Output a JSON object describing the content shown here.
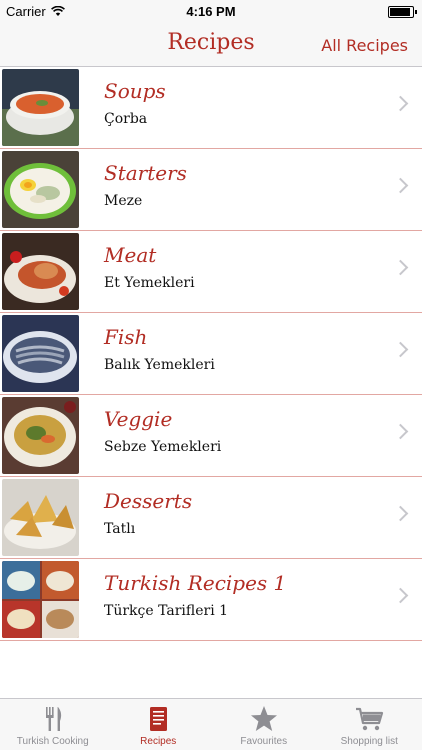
{
  "status": {
    "carrier": "Carrier",
    "time": "4:16 PM"
  },
  "nav": {
    "title": "Recipes",
    "right_button": "All Recipes"
  },
  "rows": [
    {
      "title": "Soups",
      "subtitle": "Çorba"
    },
    {
      "title": "Starters",
      "subtitle": "Meze"
    },
    {
      "title": "Meat",
      "subtitle": "Et Yemekleri"
    },
    {
      "title": "Fish",
      "subtitle": "Balık Yemekleri"
    },
    {
      "title": "Veggie",
      "subtitle": "Sebze Yemekleri"
    },
    {
      "title": "Desserts",
      "subtitle": "Tatlı"
    },
    {
      "title": "Turkish Recipes 1",
      "subtitle": "Türkçe Tarifleri 1"
    }
  ],
  "tabs": [
    {
      "label": "Turkish Cooking",
      "icon": "fork-knife-icon"
    },
    {
      "label": "Recipes",
      "icon": "book-icon"
    },
    {
      "label": "Favourites",
      "icon": "star-icon"
    },
    {
      "label": "Shopping list",
      "icon": "cart-icon"
    }
  ],
  "colors": {
    "accent": "#b22d24",
    "separator": "#e2a7a2",
    "inactive": "#8e8e93"
  }
}
